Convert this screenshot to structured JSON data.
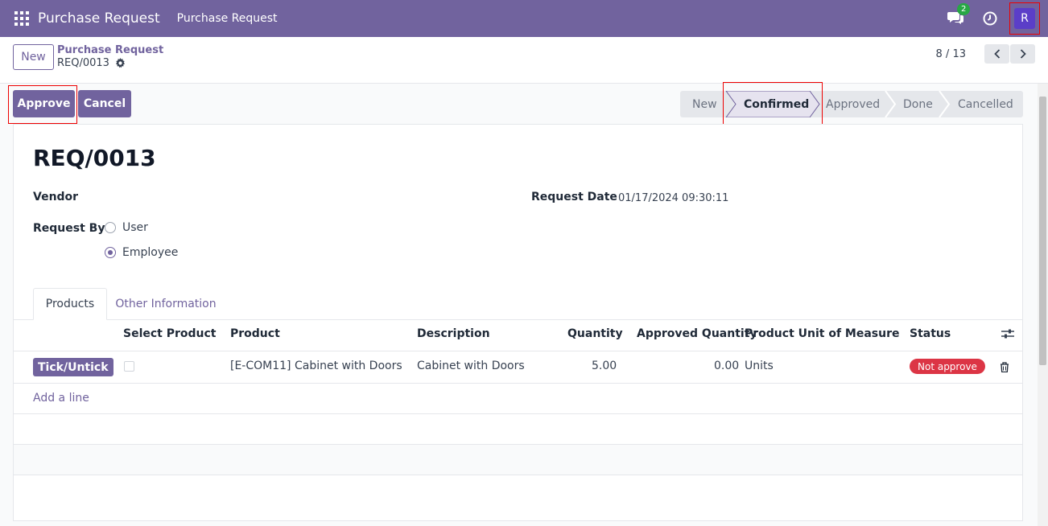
{
  "navbar": {
    "brand": "Purchase Request",
    "menu": [
      "Purchase Request"
    ],
    "chat_badge": "2",
    "avatar_initial": "R"
  },
  "control": {
    "new_label": "New",
    "breadcrumb_parent": "Purchase Request",
    "breadcrumb_current": "REQ/0013",
    "pager": "8 / 13"
  },
  "actions": {
    "approve": "Approve",
    "cancel": "Cancel"
  },
  "stages": [
    "New",
    "Confirmed",
    "Approved",
    "Done",
    "Cancelled"
  ],
  "active_stage": "Confirmed",
  "form": {
    "title": "REQ/0013",
    "vendor_label": "Vendor",
    "request_date_label": "Request Date",
    "request_date_value": "01/17/2024 09:30:11",
    "request_by_label": "Request By",
    "request_by_options": [
      "User",
      "Employee"
    ],
    "request_by_selected": "Employee"
  },
  "tabs": [
    "Products",
    "Other Information"
  ],
  "table": {
    "headers": [
      "Select Product",
      "Product",
      "Description",
      "Quantity",
      "Approved Quantity",
      "Product Unit of Measure",
      "Status"
    ],
    "row": {
      "tick_label": "Tick/Untick",
      "product": "[E-COM11] Cabinet with Doors",
      "description": "Cabinet with Doors",
      "quantity": "5.00",
      "approved_quantity": "0.00",
      "uom": "Units",
      "status": "Not approve"
    },
    "add_line": "Add a line"
  },
  "colors": {
    "brand": "#71639e",
    "highlight": "#ee0000",
    "danger": "#dc3545"
  }
}
